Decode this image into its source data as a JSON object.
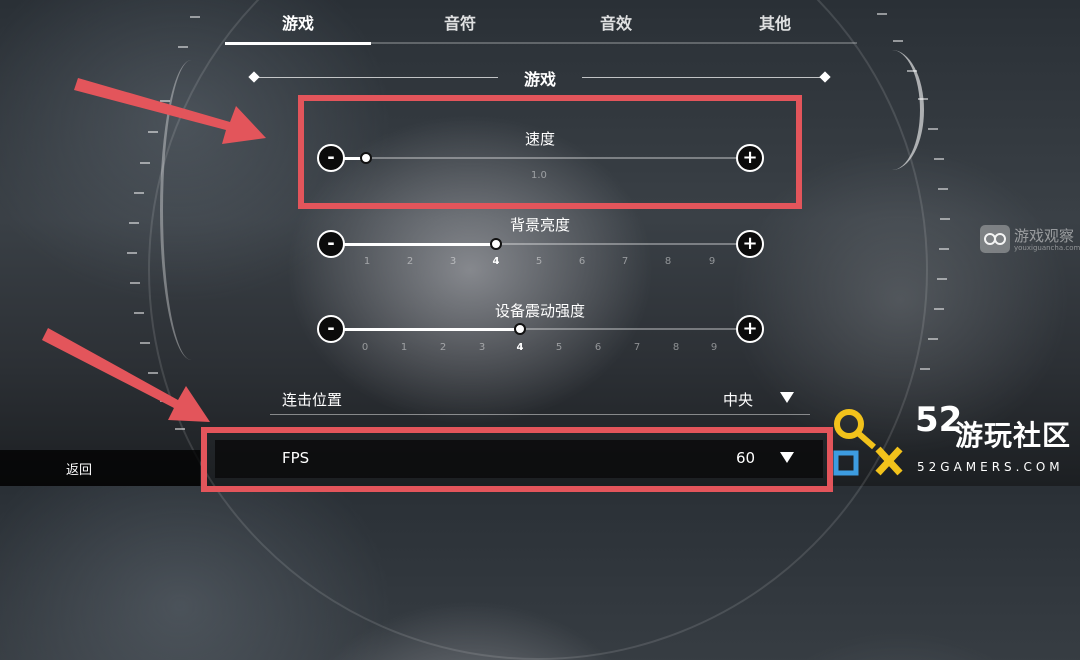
{
  "tabs": [
    {
      "label": "游戏",
      "active": true
    },
    {
      "label": "音符",
      "active": false
    },
    {
      "label": "音效",
      "active": false
    },
    {
      "label": "其他",
      "active": false
    }
  ],
  "section_title": "游戏",
  "speed": {
    "title": "速度",
    "value_text": "1.0",
    "level": 0.05
  },
  "brightness": {
    "title": "背景亮度",
    "scale": [
      "1",
      "2",
      "3",
      "4",
      "5",
      "6",
      "7",
      "8",
      "9"
    ],
    "current": "4"
  },
  "vibration": {
    "title": "设备震动强度",
    "scale": [
      "0",
      "1",
      "2",
      "3",
      "4",
      "5",
      "6",
      "7",
      "8",
      "9"
    ],
    "current": "4"
  },
  "buttons": {
    "minus": "-",
    "plus": "+"
  },
  "combo_position": {
    "label": "连击位置",
    "value": "中央"
  },
  "fps": {
    "label": "FPS",
    "value": "60"
  },
  "back_label": "返回",
  "watermarks": {
    "site1_name": "游戏观察",
    "site1_url": "youxiguancha.com",
    "site2_number": "52",
    "site2_name": "游玩社区",
    "site2_url": "52GAMERS.COM"
  },
  "colors": {
    "highlight": "#e3555b",
    "watermark_yellow": "#f2c21b",
    "watermark_blue": "#3d9ce0"
  }
}
